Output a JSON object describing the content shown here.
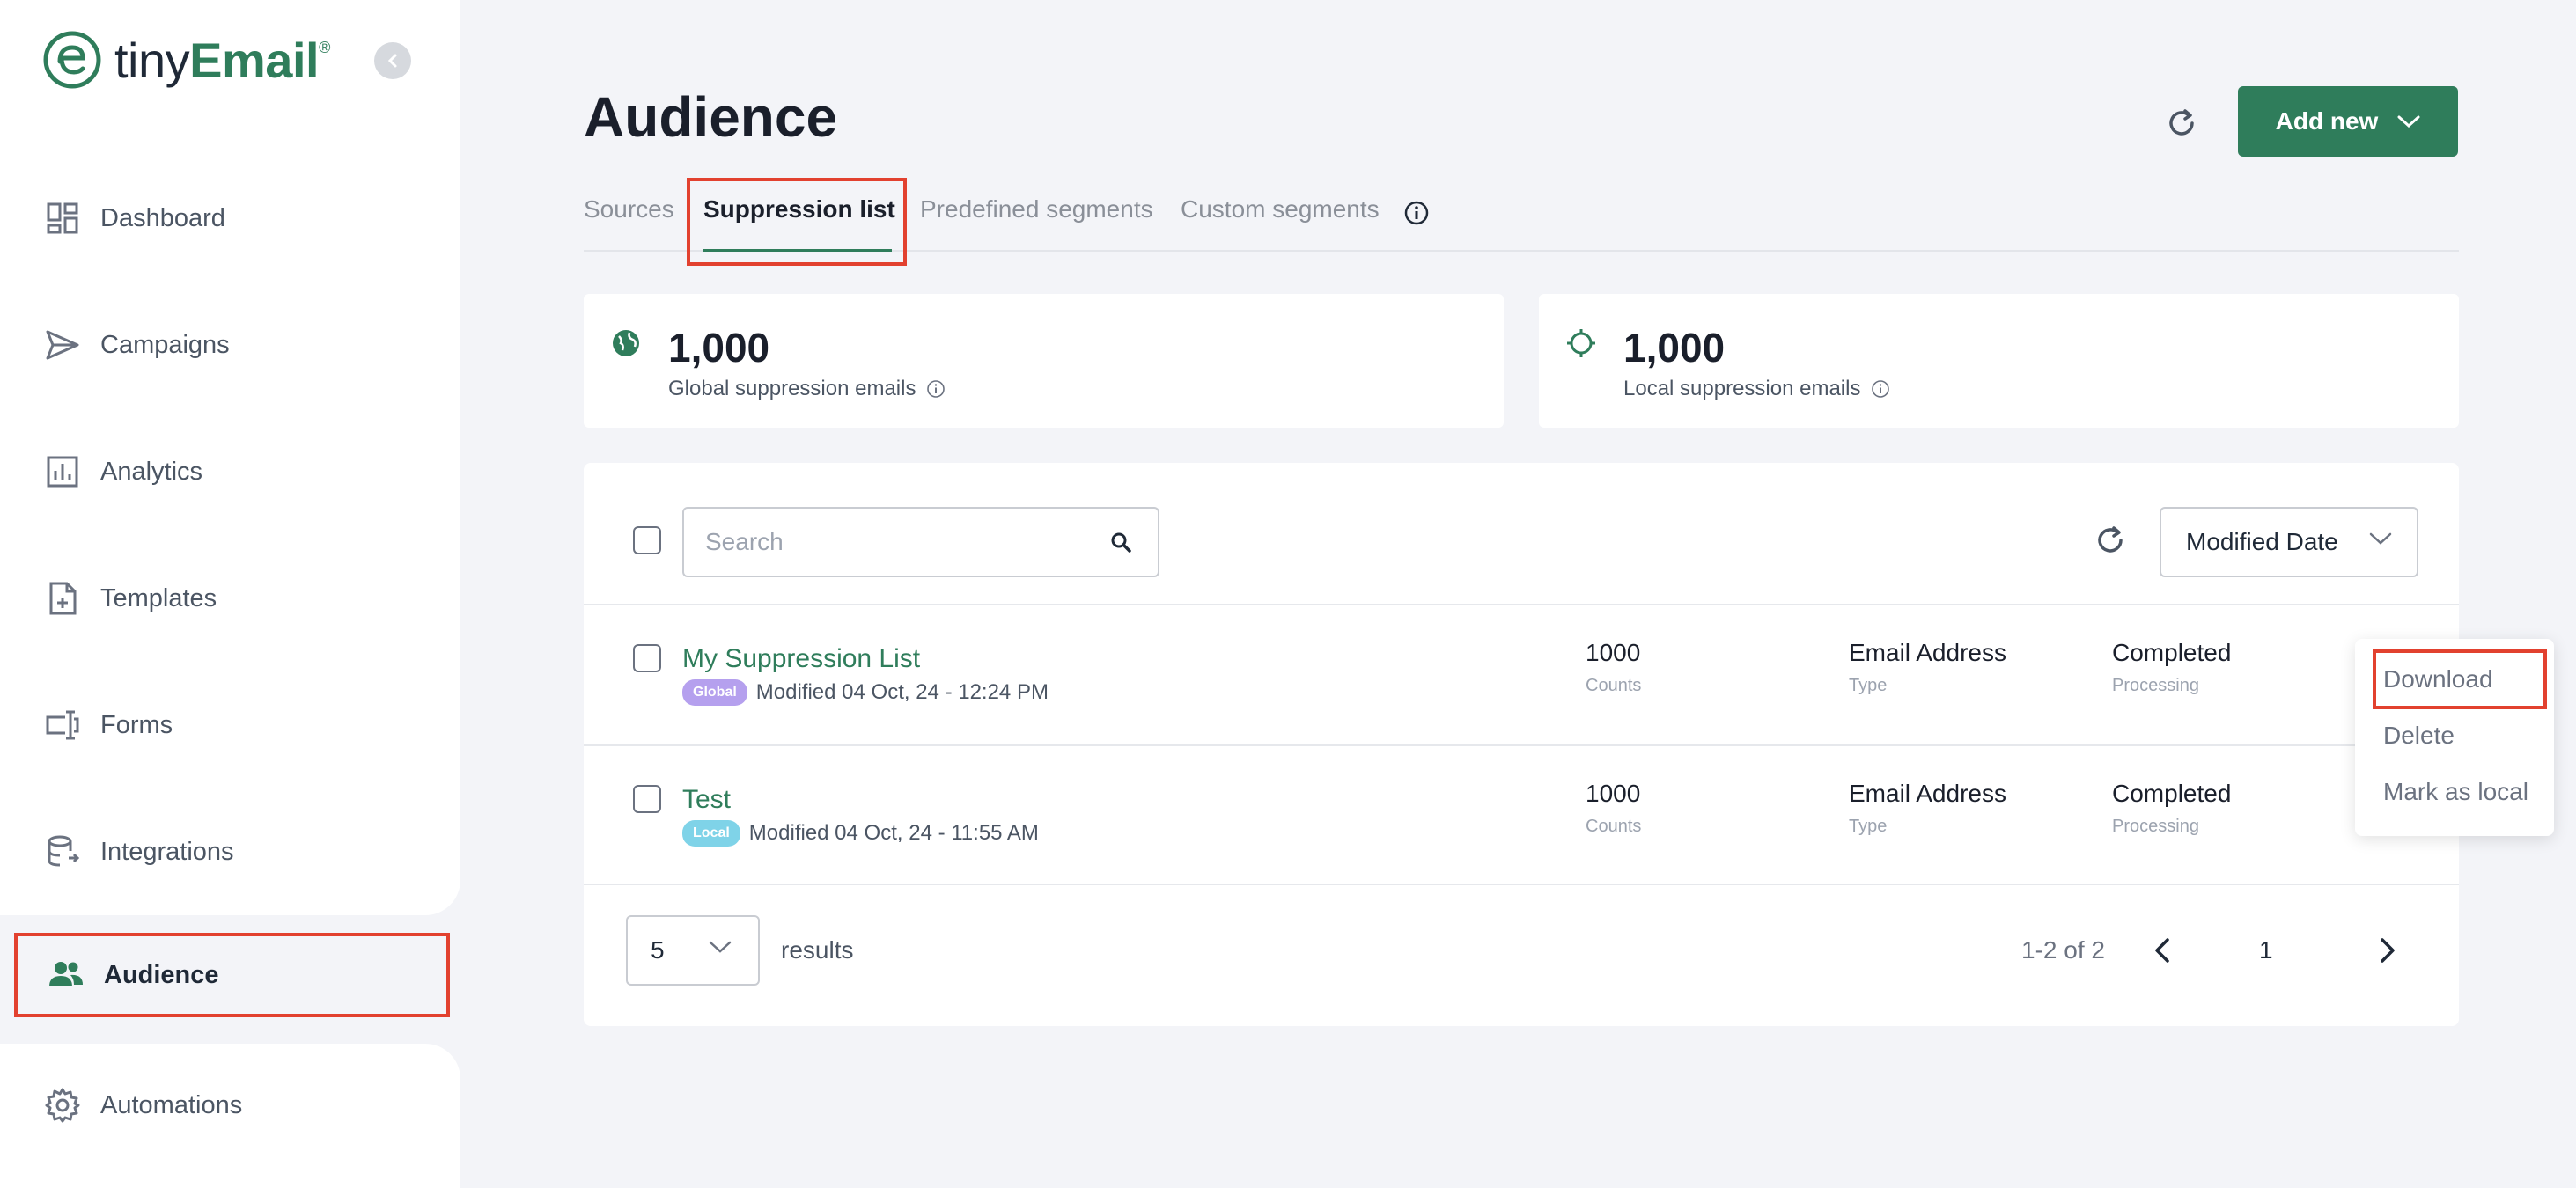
{
  "brand": {
    "name_prefix": "tiny",
    "name_suffix": "Email",
    "trademark": "®",
    "accent_color": "#2f7d5b",
    "highlight_color": "#e2412f"
  },
  "sidebar": {
    "items": [
      {
        "label": "Dashboard",
        "icon": "dashboard-icon"
      },
      {
        "label": "Campaigns",
        "icon": "send-icon"
      },
      {
        "label": "Analytics",
        "icon": "chart-icon"
      },
      {
        "label": "Templates",
        "icon": "document-plus-icon"
      },
      {
        "label": "Forms",
        "icon": "form-icon"
      },
      {
        "label": "Integrations",
        "icon": "database-icon"
      },
      {
        "label": "Audience",
        "icon": "users-icon",
        "active": true
      },
      {
        "label": "Automations",
        "icon": "gear-icon"
      }
    ]
  },
  "header": {
    "title": "Audience",
    "add_button": "Add new"
  },
  "tabs": [
    {
      "label": "Sources"
    },
    {
      "label": "Suppression list",
      "active": true
    },
    {
      "label": "Predefined segments"
    },
    {
      "label": "Custom segments"
    }
  ],
  "stats": {
    "global": {
      "value": "1,000",
      "label": "Global suppression emails"
    },
    "local": {
      "value": "1,000",
      "label": "Local suppression emails"
    }
  },
  "toolbar": {
    "search_placeholder": "Search",
    "sort_value": "Modified Date"
  },
  "rows": [
    {
      "name": "My Suppression List",
      "badge": "Global",
      "modified": "Modified 04 Oct, 24 - 12:24 PM",
      "counts": "1000",
      "counts_label": "Counts",
      "type": "Email Address",
      "type_label": "Type",
      "status": "Completed",
      "status_label": "Processing"
    },
    {
      "name": "Test",
      "badge": "Local",
      "modified": "Modified 04 Oct, 24 - 11:55 AM",
      "counts": "1000",
      "counts_label": "Counts",
      "type": "Email Address",
      "type_label": "Type",
      "status": "Completed",
      "status_label": "Processing"
    }
  ],
  "pagination": {
    "per_page": "5",
    "results_label": "results",
    "range": "1-2 of 2",
    "current_page": "1"
  },
  "context_menu": {
    "items": [
      "Download",
      "Delete",
      "Mark as local"
    ]
  }
}
